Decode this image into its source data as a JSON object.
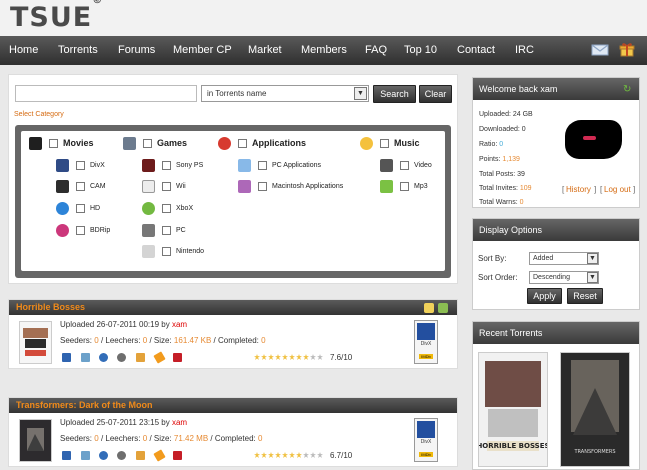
{
  "logo": {
    "text": "TSUE",
    "mark": "©"
  },
  "nav": {
    "items": [
      "Home",
      "Torrents",
      "Forums",
      "Member CP",
      "Market",
      "Members",
      "FAQ",
      "Top 10",
      "Contact",
      "IRC"
    ],
    "icons": [
      "mail-icon",
      "gift-icon"
    ]
  },
  "search": {
    "placeholder": "",
    "scope_value": "in Torrents name",
    "search_label": "Search",
    "clear_label": "Clear",
    "select_category": "Select Category"
  },
  "categories": {
    "main": [
      {
        "label": "Movies",
        "icon": "film-icon"
      },
      {
        "label": "Games",
        "icon": "joystick-icon"
      },
      {
        "label": "Applications",
        "icon": "app-icon"
      },
      {
        "label": "Music",
        "icon": "music-icon"
      }
    ],
    "movies": [
      "DivX",
      "CAM",
      "HD",
      "BDRip"
    ],
    "games": [
      "Sony PS",
      "Wii",
      "XboX",
      "PC",
      "Nintendo"
    ],
    "applications": [
      "PC Applications",
      "Macintosh Applications"
    ],
    "music": [
      "Video",
      "Mp3"
    ]
  },
  "torrents": [
    {
      "title": "Horrible Bosses",
      "uploaded": "Uploaded 26-07-2011 00:19 by",
      "user": "xam",
      "seeders_label": "Seeders:",
      "seeders": "0",
      "leechers_label": "/ Leechers:",
      "leechers": "0",
      "size_label": "/ Size:",
      "size": "161.47 KB",
      "completed_label": "/ Completed:",
      "completed": "0",
      "rating": "7.6/10",
      "rating_value": 7.6,
      "badge": "DivX",
      "badge_sub": "IMDb"
    },
    {
      "title": "Transformers: Dark of the Moon",
      "uploaded": "Uploaded 25-07-2011 23:15 by",
      "user": "xam",
      "seeders_label": "Seeders:",
      "seeders": "0",
      "leechers_label": "/ Leechers:",
      "leechers": "0",
      "size_label": "/ Size:",
      "size": "71.42 MB",
      "completed_label": "/ Completed:",
      "completed": "0",
      "rating": "6.7/10",
      "rating_value": 6.7,
      "badge": "DivX",
      "badge_sub": "IMDb"
    }
  ],
  "welcome": {
    "title": "Welcome back xam",
    "uploaded": "Uploaded: 24 GB",
    "downloaded": "Downloaded: 0",
    "ratio_label": "Ratio:",
    "ratio": "0",
    "points_label": "Points:",
    "points": "1,139",
    "posts": "Total Posts: 39",
    "invites_label": "Total Invites:",
    "invites": "109",
    "warns_label": "Total Warns:",
    "warns": "0",
    "history": "History",
    "logout": "Log out"
  },
  "display_options": {
    "title": "Display Options",
    "sort_by_label": "Sort By:",
    "sort_by_value": "Added",
    "sort_order_label": "Sort Order:",
    "sort_order_value": "Descending",
    "apply_label": "Apply",
    "reset_label": "Reset"
  },
  "recent": {
    "title": "Recent Torrents",
    "posters": [
      "HORRIBLE BOSSES",
      "TRANSFORMERS"
    ]
  },
  "colors": {
    "nav_dark": "#333333",
    "accent_orange": "#f08a1a",
    "link_red": "#d00000"
  }
}
